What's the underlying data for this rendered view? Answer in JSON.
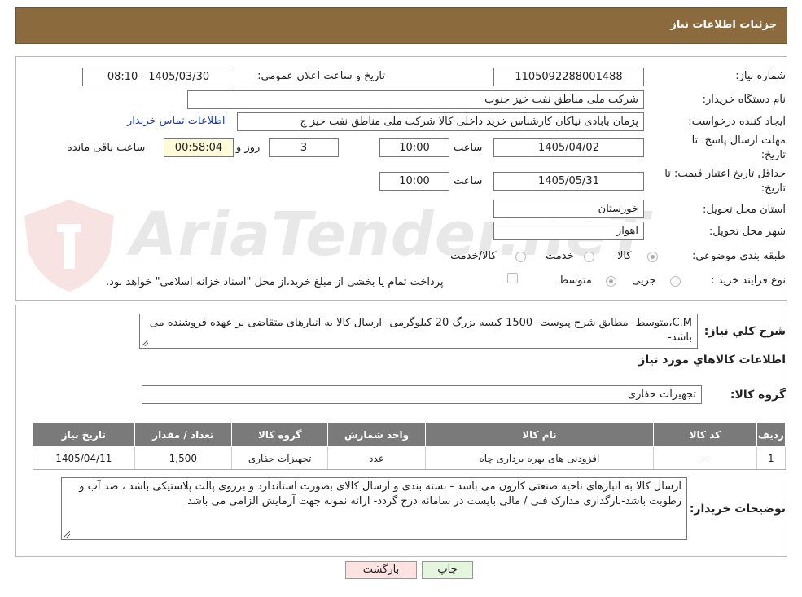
{
  "header": {
    "title": "جزئیات اطلاعات نیاز"
  },
  "form": {
    "need_number": {
      "label": "شماره نیاز:",
      "value": "1105092288001488"
    },
    "announce": {
      "label": "تاریخ و ساعت اعلان عمومی:",
      "value": "1405/03/30 - 08:10"
    },
    "buyer_org": {
      "label": "نام دستگاه خریدار:",
      "value": "شرکت ملی مناطق نفت خیز جنوب"
    },
    "requester": {
      "label": "ایجاد کننده درخواست:",
      "value": "پژمان  بابادی نیاکان  کارشناس خرید داخلی کالا  شرکت ملی مناطق نفت خیز ج"
    },
    "contact_link": "اطلاعات تماس خریدار",
    "reply_deadline": {
      "label_line1": "مهلت ارسال پاسخ: تا",
      "label_line2": "تاریخ:",
      "date": "1405/04/02",
      "time_label": "ساعت",
      "time": "10:00",
      "days": "3",
      "days_label": "روز و",
      "remaining": "00:58:04",
      "remaining_label": "ساعت باقی مانده"
    },
    "price_validity": {
      "label_line1": "حداقل تاریخ اعتبار قیمت: تا",
      "label_line2": "تاریخ:",
      "date": "1405/05/31",
      "time_label": "ساعت",
      "time": "10:00"
    },
    "province": {
      "label": "استان محل تحویل:",
      "value": "خوزستان"
    },
    "city": {
      "label": "شهر محل تحویل:",
      "value": "اهواز"
    },
    "category": {
      "label": "طبقه بندی موضوعی:",
      "options": [
        "کالا",
        "خدمت",
        "کالا/خدمت"
      ],
      "selected": "کالا"
    },
    "process": {
      "label": "نوع فرآیند خرید :",
      "options": [
        "جزیی",
        "متوسط"
      ],
      "selected": "متوسط",
      "treasury_note": "پرداخت تمام یا بخشی از مبلغ خرید،از محل \"اسناد خزانه اسلامی\" خواهد بود."
    }
  },
  "details": {
    "summary_label": "شرح کلي نياز:",
    "summary": "C.M،متوسط- مطابق شرح پیوست- 1500 کیسه بزرگ 20 کیلوگرمی--ارسال کالا به انبارهای متقاضی بر عهده فروشنده می باشد-",
    "goods_info_title": "اطلاعات کالاهاي مورد نياز",
    "goods_group_label": "گروه کالا:",
    "goods_group": "تجهیزات حفاری",
    "table": {
      "headers": [
        "ردیف",
        "کد کالا",
        "نام کالا",
        "واحد شمارش",
        "گروه کالا",
        "تعداد / مقدار",
        "تاریخ نیاز"
      ],
      "rows": [
        [
          "1",
          "--",
          "افزودنی های بهره برداری چاه",
          "عدد",
          "تجهیزات حفاری",
          "1,500",
          "1405/04/11"
        ]
      ]
    },
    "buyer_notes_label": "توضیحات خریدار:",
    "buyer_notes": "ارسال کالا به انبارهای  ناحیه صنعتی  کارون می باشد  - بسته بندی و ارسال کالای بصورت استاندارد و برروی پالت پلاستیکی باشد ، ضد آب و رطوبت باشد-بارگذاری مدارک فنی / مالی بایست  در سامانه درج گردد- ارائه نمونه جهت آزمایش الزامی می باشد"
  },
  "buttons": {
    "print": "چاپ",
    "back": "بازگشت"
  },
  "watermark": {
    "text": "AriaTender.neT"
  },
  "colors": {
    "header": "#8b6b3d",
    "table_header": "#7a7a7a",
    "remaining_bg": "#fffbd8",
    "back_button": "#fde2e2",
    "print_button": "#e4f7de",
    "link": "#1a3fb0"
  }
}
